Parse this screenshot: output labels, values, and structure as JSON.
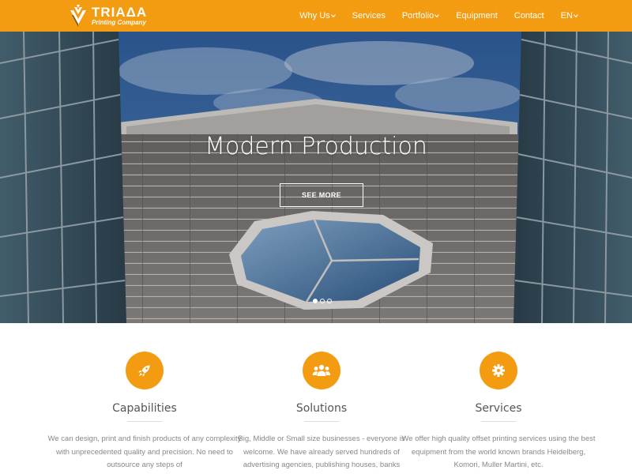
{
  "brand": {
    "name": "TRIAΔA",
    "tagline": "Printing Company",
    "color": "#f39c12"
  },
  "nav": {
    "items": [
      {
        "label": "Why Us",
        "dropdown": true
      },
      {
        "label": "Services",
        "dropdown": false
      },
      {
        "label": "Portfolio",
        "dropdown": true
      },
      {
        "label": "Equipment",
        "dropdown": false
      },
      {
        "label": "Contact",
        "dropdown": false
      },
      {
        "label": "EN",
        "dropdown": true
      }
    ]
  },
  "hero": {
    "title": "Modern Production",
    "button_label": "SEE MORE",
    "slides_total": 3,
    "active_slide": 1
  },
  "features": [
    {
      "icon": "rocket-icon",
      "title": "Capabilities",
      "text": "We can design, print and finish products of any complexity with unprecedented quality and precision. No need to outsource any steps of"
    },
    {
      "icon": "users-icon",
      "title": "Solutions",
      "text": "Big, Middle or Small size businesses - everyone is welcome. We have already served hundreds of advertising agencies, publishing houses, banks"
    },
    {
      "icon": "gear-icon",
      "title": "Services",
      "text": "We offer high quality offset printing services using the best equipment from the world known brands Heidelberg, Komori, Muller Martini, etc."
    }
  ]
}
